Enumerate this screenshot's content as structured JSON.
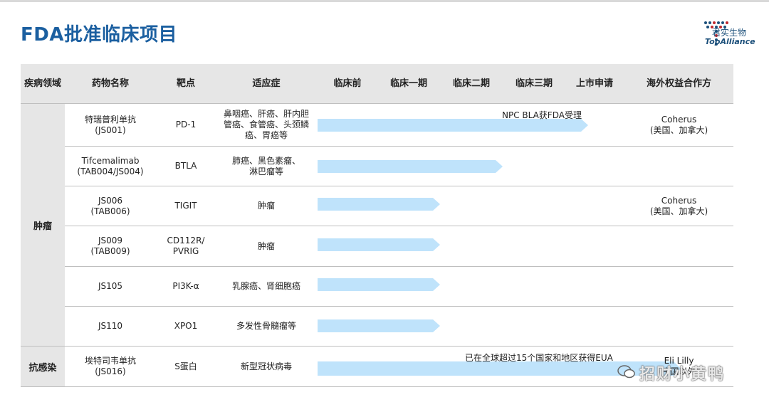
{
  "title": "FDA批准临床项目",
  "logo": {
    "cn": "君实生物",
    "en": "TopAlliance"
  },
  "headers": [
    "疾病领域",
    "药物名称",
    "靶点",
    "适应症",
    "临床前",
    "临床一期",
    "临床二期",
    "临床三期",
    "上市申请",
    "海外权益合作方"
  ],
  "groups": {
    "oncology": "肿瘤",
    "infection": "抗感染"
  },
  "rows": [
    {
      "drug": [
        "特瑞普利单抗",
        "(JS001)"
      ],
      "target": [
        "PD-1"
      ],
      "indication": [
        "鼻咽癌、肝癌、肝内胆",
        "管癌、食管癌、头颈鳞",
        "癌、胃癌等"
      ],
      "stage": "上市申请",
      "note": "NPC BLA获FDA受理",
      "partner": [
        "Coherus",
        "(美国、加拿大)"
      ]
    },
    {
      "drug": [
        "Tifcemalimab",
        "(TAB004/JS004)"
      ],
      "target": [
        "BTLA"
      ],
      "indication": [
        "肺癌、黑色素瘤、",
        "淋巴瘤等"
      ],
      "stage": "临床三期",
      "note": "",
      "partner": []
    },
    {
      "drug": [
        "JS006",
        "(TAB006)"
      ],
      "target": [
        "TIGIT"
      ],
      "indication": [
        "肿瘤"
      ],
      "stage": "临床二期",
      "note": "",
      "partner": [
        "Coherus",
        "(美国、加拿大)"
      ]
    },
    {
      "drug": [
        "JS009",
        "(TAB009)"
      ],
      "target": [
        "CD112R/",
        "PVRIG"
      ],
      "indication": [
        "肿瘤"
      ],
      "stage": "临床二期",
      "note": "",
      "partner": []
    },
    {
      "drug": [
        "JS105"
      ],
      "target": [
        "PI3K-α"
      ],
      "indication": [
        "乳腺癌、肾细胞癌"
      ],
      "stage": "临床二期",
      "note": "",
      "partner": []
    },
    {
      "drug": [
        "JS110"
      ],
      "target": [
        "XPO1"
      ],
      "indication": [
        "多发性骨髓瘤等"
      ],
      "stage": "临床二期",
      "note": "",
      "partner": []
    },
    {
      "drug": [
        "埃特司韦单抗",
        "(JS016)"
      ],
      "target": [
        "S蛋白"
      ],
      "indication": [
        "新型冠状病毒"
      ],
      "stage": "上市申请",
      "note": "已在全球超过15个国家和地区获得EUA",
      "partner": [
        "Eli Lilly",
        "(中国以外)"
      ]
    }
  ],
  "watermark": "招财小黄鸭",
  "colors": {
    "title": "#1b5fa0",
    "bar": "#bfe3fb",
    "header_bg": "#e6e6e6"
  }
}
